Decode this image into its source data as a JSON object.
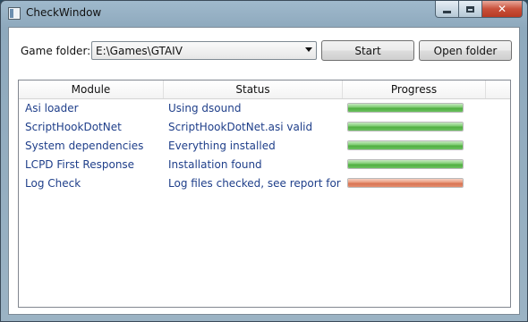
{
  "window": {
    "title": "CheckWindow"
  },
  "game_folder": {
    "label": "Game folder:",
    "value": "E:\\Games\\GTAIV"
  },
  "buttons": {
    "start": "Start",
    "open_folder": "Open folder"
  },
  "columns": {
    "module": "Module",
    "status": "Status",
    "progress": "Progress"
  },
  "rows": [
    {
      "module": "Asi loader",
      "status": "Using dsound",
      "progress": 1.0,
      "state": "ok"
    },
    {
      "module": "ScriptHookDotNet",
      "status": "ScriptHookDotNet.asi valid",
      "progress": 1.0,
      "state": "ok"
    },
    {
      "module": "System dependencies",
      "status": "Everything installed",
      "progress": 1.0,
      "state": "ok"
    },
    {
      "module": "LCPD First Response",
      "status": "Installation found",
      "progress": 1.0,
      "state": "ok"
    },
    {
      "module": "Log Check",
      "status": "Log files checked, see report for mo",
      "progress": 1.0,
      "state": "warn"
    }
  ],
  "colors": {
    "ok": "#4fae3f",
    "warn": "#d87352",
    "text_link": "#1f3f8a"
  }
}
